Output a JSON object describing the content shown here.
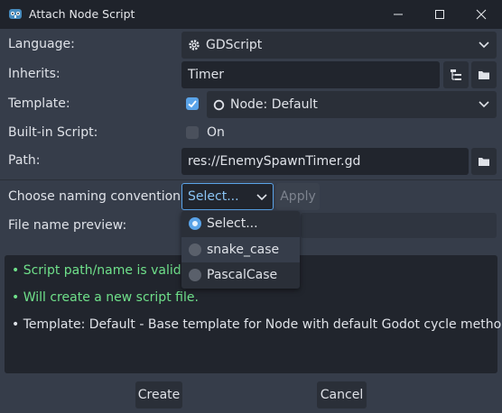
{
  "window": {
    "title": "Attach Node Script"
  },
  "form": {
    "language_label": "Language:",
    "language_value": "GDScript",
    "inherits_label": "Inherits:",
    "inherits_value": "Timer",
    "template_label": "Template:",
    "template_enabled": true,
    "template_value": "Node: Default",
    "builtin_label": "Built-in Script:",
    "builtin_enabled": false,
    "builtin_state": "On",
    "path_label": "Path:",
    "path_value": "res://EnemySpawnTimer.gd",
    "naming_label": "Choose naming convention:",
    "naming_selected": "Select...",
    "apply_label": "Apply",
    "preview_label": "File name preview:",
    "preview_value": ""
  },
  "dropdown": {
    "options": [
      {
        "label": "Select...",
        "selected": true
      },
      {
        "label": "snake_case",
        "selected": false
      },
      {
        "label": "PascalCase",
        "selected": false
      }
    ]
  },
  "messages": [
    {
      "text": "•  Script path/name is valid.",
      "status": "ok"
    },
    {
      "text": "•  Will create a new script file.",
      "status": "ok"
    },
    {
      "text": "•  Template: Default - Base template for Node with default Godot cycle methods",
      "status": "info"
    }
  ],
  "footer": {
    "create_label": "Create",
    "cancel_label": "Cancel"
  },
  "icons": {
    "app": "godot-icon",
    "language": "gear-icon",
    "template": "circle-icon",
    "browse": "folder-icon",
    "tree": "tree-icon"
  },
  "colors": {
    "accent": "#5aa3e8",
    "valid": "#6fe08a",
    "background": "#363d4a",
    "field": "#21252d"
  }
}
